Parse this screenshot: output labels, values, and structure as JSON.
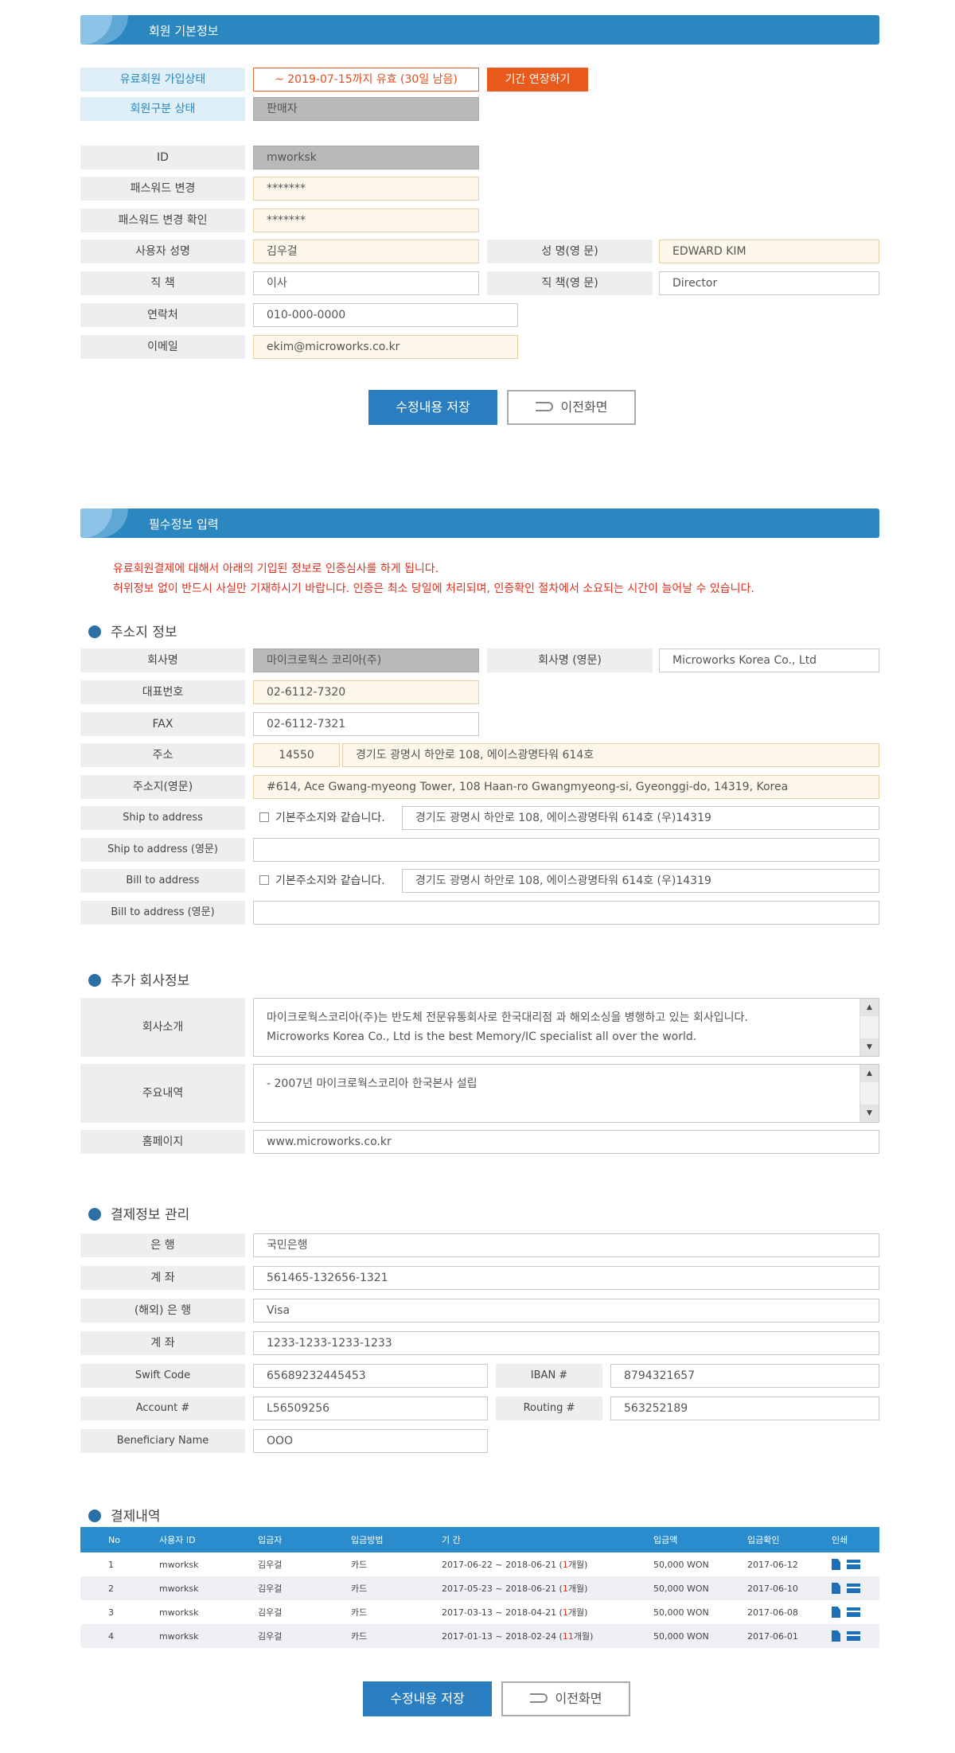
{
  "basic": {
    "section_title": "회원 기본정보",
    "paid_status_label": "유료회원 가입상태",
    "paid_status_value": "~ 2019-07-15까지 유효 (30일 남음)",
    "extend_button": "기간 연장하기",
    "member_type_label": "회원구분 상태",
    "member_type_value": "판매자",
    "id_label": "ID",
    "id_value": "mworksk",
    "pw_change_label": "패스워드 변경",
    "pw_change_value": "*******",
    "pw_confirm_label": "패스워드 변경 확인",
    "pw_confirm_value": "*******",
    "user_name_label": "사용자 성명",
    "user_name_value": "김우걸",
    "eng_name_label": "성 명(영 문)",
    "eng_name_value": "EDWARD KIM",
    "title_label": "직 책",
    "title_value": "이사",
    "eng_title_label": "직 책(영 문)",
    "eng_title_value": "Director",
    "phone_label": "연락처",
    "phone_value": "010-000-0000",
    "email_label": "이메일",
    "email_value": "ekim@microworks.co.kr",
    "save_button": "수정내용 저장",
    "back_button": "이전화면"
  },
  "required": {
    "section_title": "필수정보 입력",
    "notice_1": "유료회원결제에 대해서 아래의 기입된 정보로 인증심사를 하게 됩니다.",
    "notice_2": "허위정보 없이 반드시 사실만 기재하시기 바랍니다. 인증은 최소 당일에 처리되며, 인증확인 절차에서 소요되는 시간이 늘어날 수 있습니다."
  },
  "address": {
    "heading": "주소지 정보",
    "company_label": "회사명",
    "company_value": "마이크로웍스 코리아(주)",
    "company_eng_label": "회사명 (영문)",
    "company_eng_value": "Microworks Korea Co., Ltd",
    "tel_label": "대표번호",
    "tel_value": "02-6112-7320",
    "fax_label": "FAX",
    "fax_value": "02-6112-7321",
    "addr_label": "주소",
    "zip_value": "14550",
    "addr_value": "경기도 광명시 하안로 108, 에이스광명타워 614호",
    "addr_eng_label": "주소지(영문)",
    "addr_eng_value": "#614, Ace Gwang-myeong Tower, 108 Haan-ro Gwangmyeong-si, Gyeonggi-do, 14319, Korea",
    "ship_label": "Ship to address",
    "same_as_base": "기본주소지와 같습니다.",
    "ship_value": "경기도 광명시 하안로 108, 에이스광명타워 614호 (우)14319",
    "ship_eng_label": "Ship to address (영문)",
    "ship_eng_value": "",
    "bill_label": "Bill to address",
    "bill_value": "경기도 광명시 하안로 108, 에이스광명타워 614호 (우)14319",
    "bill_eng_label": "Bill to address (영문)",
    "bill_eng_value": ""
  },
  "extra": {
    "heading": "추가 회사정보",
    "intro_label": "회사소개",
    "intro_line1": "마이크로웍스코리아(주)는 반도체 전문유통회사로 한국대리점 과 해외소싱을 병행하고 있는 회사입니다.",
    "intro_line2": "Microworks Korea Co., Ltd is the best Memory/IC specialist all over the world.",
    "history_label": "주요내역",
    "history_line1": "- 2007년 마이크로웍스코리아 한국본사 설립",
    "homepage_label": "홈페이지",
    "homepage_value": "www.microworks.co.kr"
  },
  "payment_info": {
    "heading": "결제정보 관리",
    "bank_label": "은 행",
    "bank_value": "국민은행",
    "account_label": "계 좌",
    "account_value": "561465-132656-1321",
    "foreign_bank_label": "(해외) 은 행",
    "foreign_bank_value": "Visa",
    "foreign_account_label": "계 좌",
    "foreign_account_value": "1233-1233-1233-1233",
    "swift_label": "Swift Code",
    "swift_value": "65689232445453",
    "iban_label": "IBAN #",
    "iban_value": "8794321657",
    "acctno_label": "Account #",
    "acctno_value": "L56509256",
    "routing_label": "Routing #",
    "routing_value": "563252189",
    "beneficiary_label": "Beneficiary Name",
    "beneficiary_value": "OOO"
  },
  "history": {
    "heading": "결제내역",
    "columns": [
      "No",
      "사용자 ID",
      "입금자",
      "입금방법",
      "기 간",
      "입금액",
      "입금확인",
      "인쇄"
    ],
    "rows": [
      {
        "no": "1",
        "uid": "mworksk",
        "payer": "김우걸",
        "method": "카드",
        "period": "2017-06-22 ~ 2018-06-21 (",
        "months": "1",
        "unit": "개월)",
        "amount": "50,000 WON",
        "confirm": "2017-06-12"
      },
      {
        "no": "2",
        "uid": "mworksk",
        "payer": "김우걸",
        "method": "카드",
        "period": "2017-05-23 ~ 2018-06-21 (",
        "months": "1",
        "unit": "개월)",
        "amount": "50,000 WON",
        "confirm": "2017-06-10"
      },
      {
        "no": "3",
        "uid": "mworksk",
        "payer": "김우걸",
        "method": "카드",
        "period": "2017-03-13 ~ 2018-04-21 (",
        "months": "1",
        "unit": "개월)",
        "amount": "50,000 WON",
        "confirm": "2017-06-08"
      },
      {
        "no": "4",
        "uid": "mworksk",
        "payer": "김우걸",
        "method": "카드",
        "period": "2017-01-13 ~ 2018-02-24 (",
        "months": "11",
        "unit": "개월)",
        "amount": "50,000 WON",
        "confirm": "2017-06-01"
      }
    ],
    "save_button": "수정내용 저장",
    "back_button": "이전화면"
  }
}
